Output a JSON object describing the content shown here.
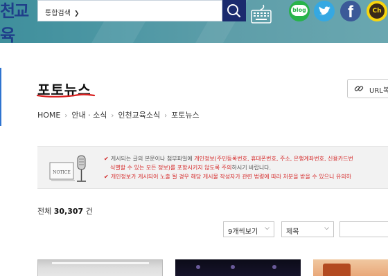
{
  "header": {
    "logo_fragment": "천교육",
    "search": {
      "scope_label": "통합검색",
      "placeholder": ""
    },
    "social": {
      "blog_label": "blog",
      "facebook_label": "f",
      "kakao_label": "Ch"
    },
    "colors": {
      "band": "#4d97a4",
      "search_button": "#1b2b6e"
    }
  },
  "page": {
    "title": "포토뉴스",
    "url_button_label": "URL복"
  },
  "breadcrumb": [
    "HOME",
    "안내 · 소식",
    "인천교육소식",
    "포토뉴스"
  ],
  "notice": {
    "image_label": "NOTICE",
    "lines": [
      {
        "prefix": "게시되는 글의 본문이나 첨부파일에 ",
        "highlight": "개인정보(주민등록번호, 휴대폰번호, 주소, 은행계좌번호, 신용카드번"
      },
      {
        "prefix": "",
        "highlight": "식별할 수 있는 모든 정보)를 포함시키지 않도록 주의",
        "suffix": "하시기 바랍니다."
      },
      {
        "prefix": "",
        "highlight": "개인정보가 게시되어 노출 될 경우 해당 게시물 작성자가 관련 법령에 따라 처분을 받을 수 있으니 유의하"
      }
    ]
  },
  "list": {
    "total_prefix": "전체",
    "total_count": "30,307",
    "total_suffix": "건",
    "view_select": "9개씩보기",
    "field_select": "제목",
    "search_value": ""
  }
}
